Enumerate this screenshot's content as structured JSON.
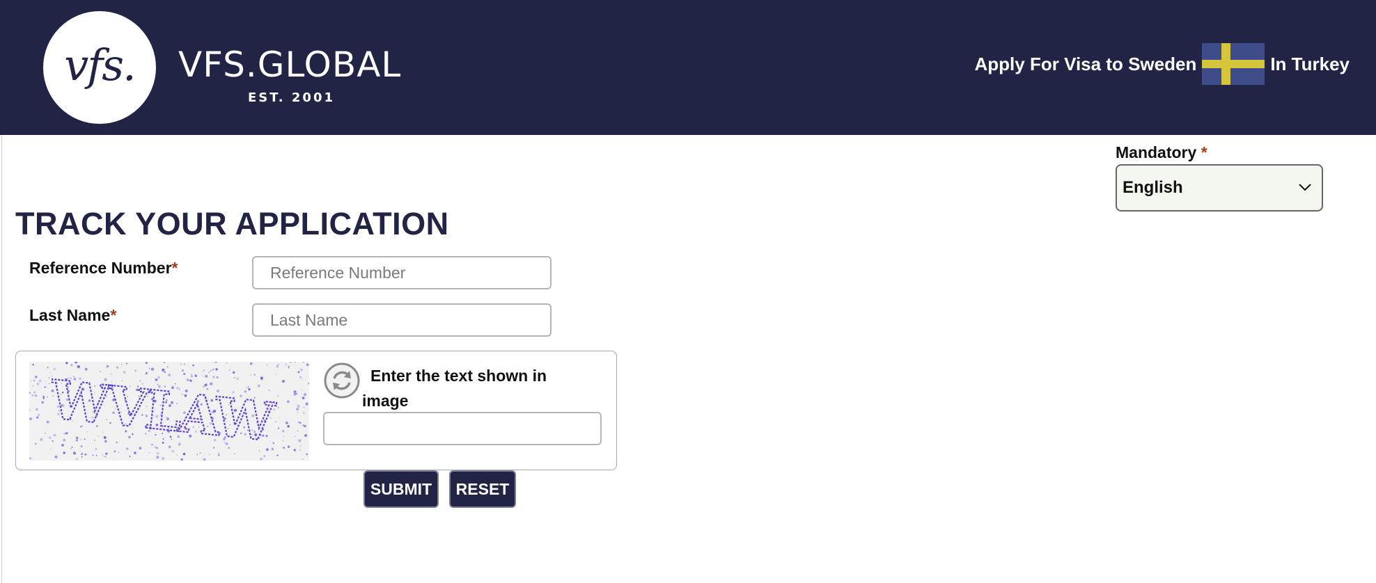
{
  "header": {
    "logo_mark": "vfs.",
    "brand_name": "VFS.GLOBAL",
    "brand_est": "EST. 2001",
    "apply_text": "Apply For Visa to Sweden",
    "country_text": "In Turkey",
    "flag_icon": "sweden-flag-icon"
  },
  "language": {
    "label": "Mandatory",
    "required_marker": "*",
    "selected": "English"
  },
  "page_title": "TRACK YOUR APPLICATION",
  "form": {
    "reference_label": "Reference Number",
    "reference_placeholder": "Reference Number",
    "reference_value": "",
    "last_name_label": "Last Name",
    "last_name_placeholder": "Last Name",
    "last_name_value": "",
    "required_marker": "*"
  },
  "captcha": {
    "image_text": "WVLAW",
    "prompt": "Enter the text shown in image",
    "input_value": "",
    "refresh_icon": "refresh-icon"
  },
  "buttons": {
    "submit": "SUBMIT",
    "reset": "RESET"
  },
  "colors": {
    "brand_navy": "#212444",
    "required_star": "#a0411d",
    "flag_blue": "#3f4c8a",
    "flag_yellow": "#d6c43c"
  }
}
